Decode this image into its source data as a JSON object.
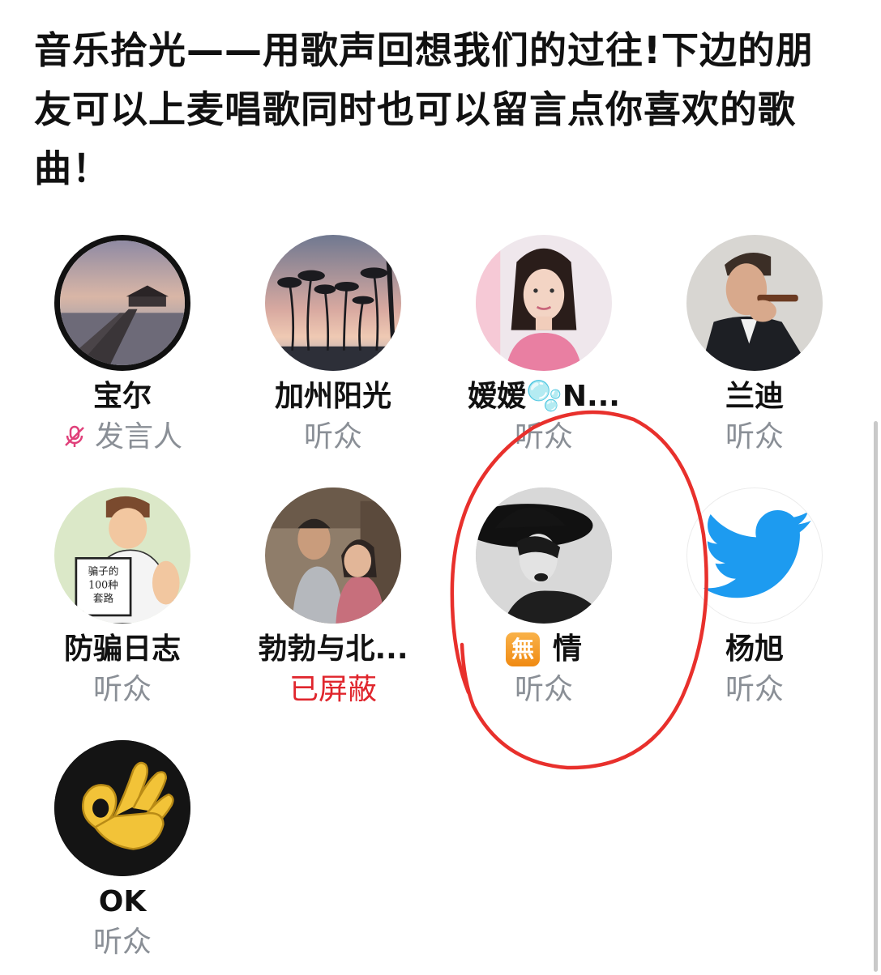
{
  "space": {
    "title": "音乐拾光——用歌声回想我们的过往!下边的朋友可以上麦唱歌同时也可以留言点你喜欢的歌曲！"
  },
  "participants": [
    {
      "name": "宝尔",
      "role": "发言人",
      "muted": true,
      "avatar": "sunset-pier-photo"
    },
    {
      "name": "加州阳光",
      "role": "听众",
      "avatar": "palm-trees-silhouette-photo"
    },
    {
      "name": "嫒嫒🫧N...",
      "role": "听众",
      "avatar": "woman-portrait-photo"
    },
    {
      "name": "兰迪",
      "role": "听众",
      "avatar": "man-with-cigar-photo"
    },
    {
      "name": "防骗日志",
      "role": "听众",
      "avatar": "cartoon-man-reading-book",
      "book_text": [
        "骗子的",
        "100种",
        "套路"
      ]
    },
    {
      "name": "勃勃与北...",
      "role": "已屏蔽",
      "blocked": true,
      "avatar": "couple-photo"
    },
    {
      "name": "情",
      "badge": "無",
      "role": "听众",
      "highlighted": true,
      "avatar": "woman-black-hat-photo"
    },
    {
      "name": "杨旭",
      "role": "听众",
      "avatar": "twitter-bird-logo"
    },
    {
      "name": "OK",
      "role": "听众",
      "avatar": "ok-hand-emoji"
    }
  ],
  "colors": {
    "listener_role": "#8a8f96",
    "blocked_role": "#e0262d",
    "mic_off": "#e0407a",
    "annotation": "#e8302c",
    "twitter_blue": "#1d9bf0"
  }
}
